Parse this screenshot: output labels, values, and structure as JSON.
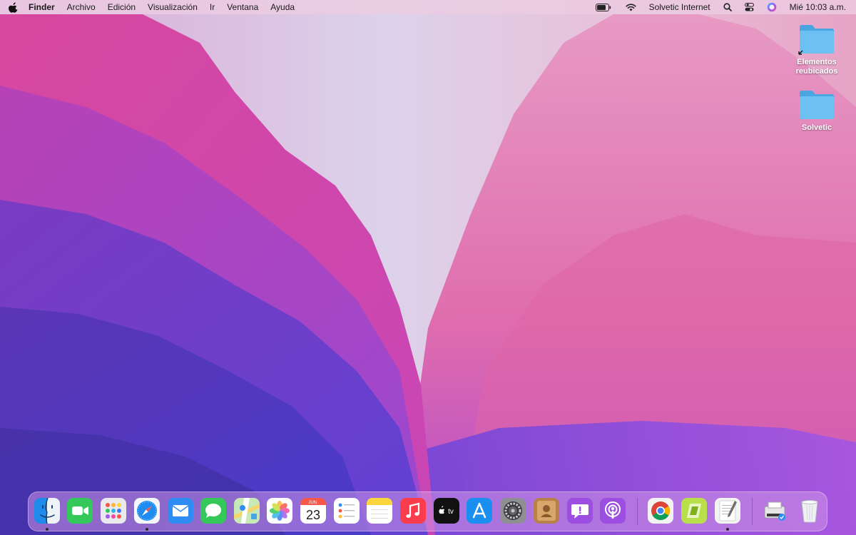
{
  "menubar": {
    "app_name": "Finder",
    "menus": [
      "Archivo",
      "Edición",
      "Visualización",
      "Ir",
      "Ventana",
      "Ayuda"
    ],
    "status": {
      "battery_icon": "battery-icon",
      "wifi_icon": "wifi-icon",
      "network_label": "Solvetic Internet",
      "search_icon": "search-icon",
      "control_center_icon": "control-center-icon",
      "siri_icon": "siri-icon",
      "clock": "Mié 10:03 a.m."
    }
  },
  "desktop": {
    "icons": [
      {
        "label": "Elementos reubicados",
        "icon": "folder-alias-icon"
      },
      {
        "label": "Solvetic",
        "icon": "folder-icon"
      }
    ]
  },
  "dock": {
    "apps": [
      {
        "name": "finder",
        "running": true
      },
      {
        "name": "facetime",
        "running": false
      },
      {
        "name": "launchpad",
        "running": false
      },
      {
        "name": "safari",
        "running": true
      },
      {
        "name": "mail",
        "running": false
      },
      {
        "name": "messages",
        "running": false
      },
      {
        "name": "maps",
        "running": false
      },
      {
        "name": "photos",
        "running": false
      },
      {
        "name": "calendar",
        "running": false
      },
      {
        "name": "reminders",
        "running": false
      },
      {
        "name": "notes",
        "running": false
      },
      {
        "name": "music",
        "running": false
      },
      {
        "name": "apple-tv",
        "running": false
      },
      {
        "name": "app-store",
        "running": false
      },
      {
        "name": "system-preferences",
        "running": false
      },
      {
        "name": "contacts",
        "running": false
      },
      {
        "name": "feedback-assistant",
        "running": false
      },
      {
        "name": "podcasts",
        "running": false
      },
      {
        "name": "chrome",
        "running": false
      },
      {
        "name": "camtasia",
        "running": false
      },
      {
        "name": "textedit",
        "running": true
      },
      {
        "name": "printer",
        "running": false
      },
      {
        "name": "trash",
        "running": false
      }
    ],
    "calendar": {
      "month": "JUN.",
      "day": "23"
    },
    "tv_label": "tv",
    "colors": {
      "facetime": "#34c759",
      "messages": "#34c759",
      "safari": "#1e8cf0",
      "mail": "#2f8cf5",
      "music": "#fa3c4c",
      "podcasts": "#9b4ee0",
      "app_store": "#1b8ff0"
    }
  }
}
